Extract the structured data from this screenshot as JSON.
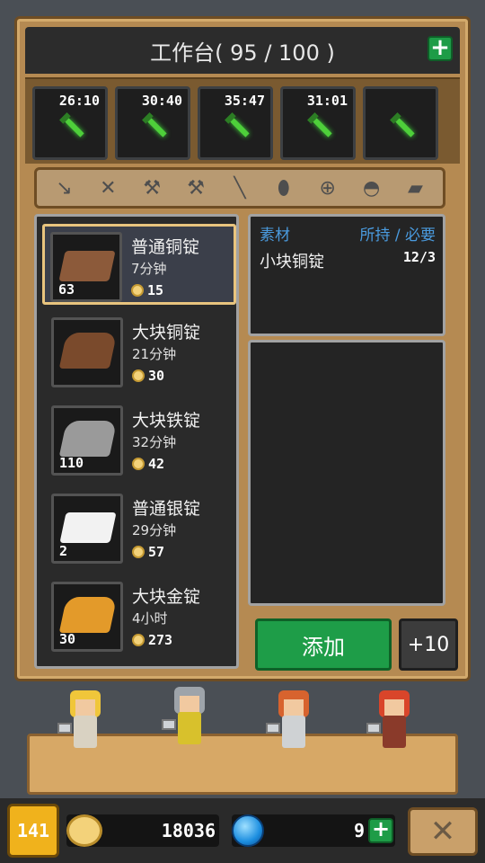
{
  "header": {
    "title": "工作台( 95 / 100 )",
    "add_icon": "plus-icon"
  },
  "queue": [
    {
      "time": "26:10",
      "icon": "sword-icon"
    },
    {
      "time": "30:40",
      "icon": "sword-icon"
    },
    {
      "time": "35:47",
      "icon": "sword-icon"
    },
    {
      "time": "31:01",
      "icon": "sword-icon"
    },
    {
      "time": "",
      "icon": "sword-icon"
    }
  ],
  "tabs": [
    {
      "icon": "dagger-icon",
      "glyph": "↘"
    },
    {
      "icon": "crossed-swords-icon",
      "glyph": "✕"
    },
    {
      "icon": "axe-icon",
      "glyph": "⚒"
    },
    {
      "icon": "hammer-icon",
      "glyph": "⚒"
    },
    {
      "icon": "spear-icon",
      "glyph": "╲"
    },
    {
      "icon": "shield-icon",
      "glyph": "⬮"
    },
    {
      "icon": "bow-icon",
      "glyph": "⊕"
    },
    {
      "icon": "pot-icon",
      "glyph": "◓"
    },
    {
      "icon": "scroll-icon",
      "glyph": "▰"
    }
  ],
  "recipes": [
    {
      "name": "普通铜锭",
      "time": "7分钟",
      "price": "15",
      "count": "63",
      "color": "#8c5a3a"
    },
    {
      "name": "大块铜锭",
      "time": "21分钟",
      "price": "30",
      "count": "",
      "color": "#7a4a2c"
    },
    {
      "name": "大块铁锭",
      "time": "32分钟",
      "price": "42",
      "count": "110",
      "color": "#9a9a9a"
    },
    {
      "name": "普通银锭",
      "time": "29分钟",
      "price": "57",
      "count": "2",
      "color": "#f2f2f2"
    },
    {
      "name": "大块金锭",
      "time": "4小时",
      "price": "273",
      "count": "30",
      "color": "#e39a2a"
    }
  ],
  "materials": {
    "header_left": "素材",
    "header_right": "所持 / 必要",
    "item_name": "小块铜锭",
    "item_qty": "12/3"
  },
  "actions": {
    "add": "添加",
    "plus10": "+10"
  },
  "bottom": {
    "level": "141",
    "gold": "18036",
    "gems": "9",
    "close_glyph": "✕"
  },
  "colors": {
    "accent_green": "#1e9d48",
    "wood": "#b58a52",
    "highlight": "#4a9bdf"
  }
}
